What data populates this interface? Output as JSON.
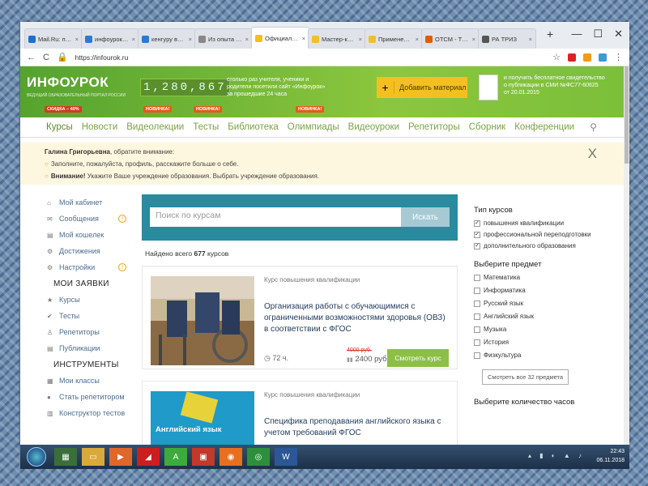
{
  "tabs": [
    {
      "label": "Mail.Ru: почта, поиск",
      "color": "#1d6fd1",
      "active": false
    },
    {
      "label": "инфоурок грамоты",
      "color": "#2a7ad5",
      "active": false
    },
    {
      "label": "кенгуру всероссийский",
      "color": "#2a7ad5",
      "active": false
    },
    {
      "label": "Из опыта работы",
      "color": "#888888",
      "active": false
    },
    {
      "label": "Официальный сайт",
      "color": "#f4c021",
      "active": true
    },
    {
      "label": "Мастер-класс по",
      "color": "#f4c021",
      "active": false
    },
    {
      "label": "Применение ТРИЗ",
      "color": "#f4c021",
      "active": false
    },
    {
      "label": "ОТСМ - ТРИЗ - ТР",
      "color": "#e55a00",
      "active": false
    },
    {
      "label": "РА ТРИЗ",
      "color": "#555555",
      "active": false
    }
  ],
  "window_controls": {
    "new_tab": "+",
    "minimize": "—",
    "maximize": "☐",
    "close": "✕"
  },
  "address": {
    "url": "https://infourok.ru",
    "back": "←",
    "reload": "C"
  },
  "header": {
    "logo": "ИНФОУРОК",
    "logo_sub": "ВЕДУЩИЙ ОБРАЗОВАТЕЛЬНЫЙ ПОРТАЛ РОССИИ",
    "counter": "1,280,867",
    "counter_text": "столько раз учителя, ученики и родители посетили сайт «Инфоурок» за прошедшие 24 часа",
    "add_button": "Добавить материал",
    "cert_text": "и получить бесплатное свидетельство о публикации в СМИ №ФС77-60625 от 20.01.2015",
    "badge_discount": "СКИДКА – 40%",
    "badge_new": "НОВИНКА!"
  },
  "nav": [
    "Курсы",
    "Новости",
    "Видеолекции",
    "Тесты",
    "Библиотека",
    "Олимпиады",
    "Видеоуроки",
    "Репетиторы",
    "Сборник",
    "Конференции"
  ],
  "notice": {
    "name": "Галина Григорьевна",
    "attention": ", обратите внимание:",
    "line1": "Заполните, пожалуйста, профиль, расскажите больше о себе.",
    "line2_bold": "Внимание!",
    "line2": " Укажите Ваше учреждение образования. Выбрать учреждение образования.",
    "close": "X"
  },
  "sidebar": {
    "items": [
      "Мой кабинет",
      "Сообщения",
      "Мой кошелек",
      "Достижения",
      "Настройки"
    ],
    "section1": "МОИ ЗАЯВКИ",
    "items2": [
      "Курсы",
      "Тесты",
      "Репетиторы",
      "Публикации"
    ],
    "section2": "ИНСТРУМЕНТЫ",
    "items3": [
      "Мои классы",
      "Стать репетитором",
      "Конструктор тестов"
    ]
  },
  "search": {
    "placeholder": "Поиск по курсам",
    "button": "Искать"
  },
  "found": {
    "prefix": "Найдено всего ",
    "count": "677",
    "suffix": " курсов"
  },
  "courses": [
    {
      "type": "Курс повышения квалификации",
      "title": "Организация работы с обучающимися с ограниченными возможностями здоровья (ОВЗ) в соответствии с ФГОС",
      "hours": "72 ч.",
      "old_price": "4000 руб.",
      "price": "2400 руб.",
      "button": "Смотреть курс"
    },
    {
      "type": "Курс повышения квалификации",
      "title": "Специфика преподавания английского языка с учетом требований ФГОС",
      "image_label": "Английский язык"
    }
  ],
  "filters": {
    "type_title": "Тип курсов",
    "types": [
      "повышения квалификации",
      "профессиональной переподготовки",
      "дополнительного образования"
    ],
    "subject_title": "Выберите предмет",
    "subjects": [
      "Математика",
      "Информатика",
      "Русский язык",
      "Английский язык",
      "Музыка",
      "История",
      "Физкультура"
    ],
    "all_button": "Смотреть все 32 предмета",
    "hours_title": "Выберите количество часов"
  },
  "taskbar": {
    "time": "22:43",
    "date": "06.11.2018"
  }
}
